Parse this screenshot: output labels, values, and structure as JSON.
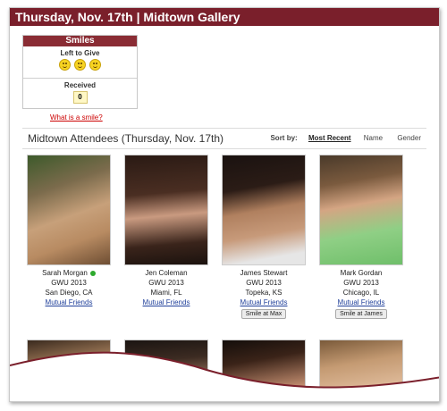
{
  "header": {
    "title": "Thursday, Nov. 17th | Midtown Gallery"
  },
  "smiles": {
    "title": "Smiles",
    "left_label": "Left to Give",
    "left_count": 3,
    "received_label": "Received",
    "received_count": "0",
    "what_link": "What is a smile?"
  },
  "section": {
    "title": "Midtown Attendees (Thursday, Nov. 17th)",
    "sort_label": "Sort by:",
    "sort_options": [
      "Most Recent",
      "Name",
      "Gender"
    ],
    "active_sort": "Most Recent"
  },
  "attendees": [
    {
      "name": "Sarah Morgan",
      "school": "GWU 2013",
      "city": "San Diego, CA",
      "mutual": "Mutual Friends",
      "online": true,
      "smile_button": ""
    },
    {
      "name": "Jen Coleman",
      "school": "GWU 2013",
      "city": "Miami, FL",
      "mutual": "Mutual Friends",
      "online": false,
      "smile_button": ""
    },
    {
      "name": "James Stewart",
      "school": "GWU 2013",
      "city": "Topeka, KS",
      "mutual": "Mutual Friends",
      "online": false,
      "smile_button": "Smile at Max"
    },
    {
      "name": "Mark Gordan",
      "school": "GWU 2013",
      "city": "Chicago, IL",
      "mutual": "Mutual Friends",
      "online": false,
      "smile_button": "Smile at James"
    }
  ],
  "colors": {
    "brand": "#7a1f2b",
    "link": "#1f3f9a",
    "online": "#2eaa2e"
  }
}
